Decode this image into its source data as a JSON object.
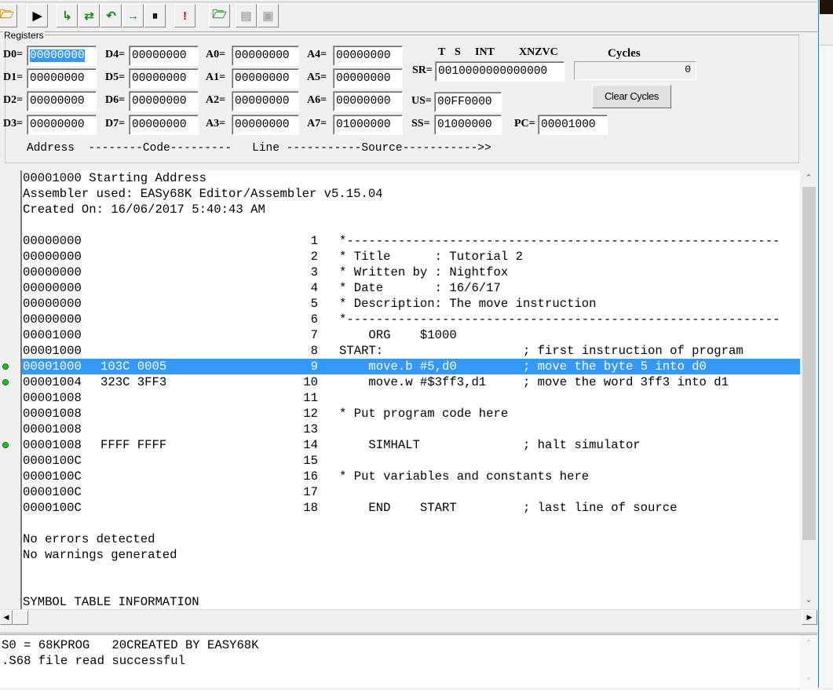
{
  "toolbar": {
    "buttons": [
      {
        "name": "open-file",
        "icon": "folder-open-icon",
        "glyph": "🗁",
        "color": "#c89b00",
        "enabled": true
      },
      {
        "name": "run",
        "icon": "run-icon",
        "glyph": "▶",
        "color": "#000",
        "enabled": true
      },
      {
        "name": "step-into",
        "icon": "step-into-icon",
        "glyph": "↳",
        "color": "#1a8a1a",
        "enabled": true
      },
      {
        "name": "step-over",
        "icon": "step-over-icon",
        "glyph": "⇄",
        "color": "#1a8a1a",
        "enabled": true
      },
      {
        "name": "trace",
        "icon": "trace-icon",
        "glyph": "↶",
        "color": "#1a8a1a",
        "enabled": true
      },
      {
        "name": "run-to-cursor",
        "icon": "run-to-cursor-icon",
        "glyph": "→",
        "color": "#1a8a1a",
        "enabled": true
      },
      {
        "name": "pause",
        "icon": "pause-icon",
        "glyph": "⏸",
        "color": "#000",
        "enabled": true
      },
      {
        "name": "reset",
        "icon": "reset-icon",
        "glyph": "!",
        "color": "#e00000",
        "enabled": true
      },
      {
        "name": "reload",
        "icon": "reload-folder-icon",
        "glyph": "🗁",
        "color": "#2a9a2a",
        "enabled": true
      },
      {
        "name": "log-start",
        "icon": "log-start-icon",
        "glyph": "▤",
        "color": "#aaa",
        "enabled": false
      },
      {
        "name": "log-stop",
        "icon": "log-stop-icon",
        "glyph": "▣",
        "color": "#aaa",
        "enabled": false
      }
    ]
  },
  "registers": {
    "group_label": "Registers",
    "D": [
      {
        "label": "D0=",
        "value": "00000000"
      },
      {
        "label": "D1=",
        "value": "00000000"
      },
      {
        "label": "D2=",
        "value": "00000000"
      },
      {
        "label": "D3=",
        "value": "00000000"
      },
      {
        "label": "D4=",
        "value": "00000000"
      },
      {
        "label": "D5=",
        "value": "00000000"
      },
      {
        "label": "D6=",
        "value": "00000000"
      },
      {
        "label": "D7=",
        "value": "00000000"
      }
    ],
    "A": [
      {
        "label": "A0=",
        "value": "00000000"
      },
      {
        "label": "A1=",
        "value": "00000000"
      },
      {
        "label": "A2=",
        "value": "00000000"
      },
      {
        "label": "A3=",
        "value": "00000000"
      },
      {
        "label": "A4=",
        "value": "00000000"
      },
      {
        "label": "A5=",
        "value": "00000000"
      },
      {
        "label": "A6=",
        "value": "00000000"
      },
      {
        "label": "A7=",
        "value": "01000000"
      }
    ],
    "sr_header": {
      "t": "T",
      "s": "S",
      "int": "INT",
      "flags": "XNZVC"
    },
    "SR": {
      "label": "SR=",
      "value": "0010000000000000"
    },
    "US": {
      "label": "US=",
      "value": "00FF0000"
    },
    "SS": {
      "label": "SS=",
      "value": "01000000"
    },
    "PC": {
      "label": "PC=",
      "value": "00001000"
    },
    "cycles_label": "Cycles",
    "cycles_value": "0",
    "clear_cycles": "Clear Cycles"
  },
  "column_header": "Address  --------Code---------   Line -----------Source----------->>",
  "listing": [
    {
      "text": "00001000 Starting Address"
    },
    {
      "text": "Assembler used: EASy68K Editor/Assembler v5.15.04"
    },
    {
      "text": "Created On: 16/06/2017 5:40:43 AM"
    },
    {
      "text": ""
    },
    {
      "addr": "00000000",
      "code": "",
      "line": "1",
      "src": "*-----------------------------------------------------------"
    },
    {
      "addr": "00000000",
      "code": "",
      "line": "2",
      "src": "* Title      : Tutorial 2"
    },
    {
      "addr": "00000000",
      "code": "",
      "line": "3",
      "src": "* Written by : Nightfox"
    },
    {
      "addr": "00000000",
      "code": "",
      "line": "4",
      "src": "* Date       : 16/6/17"
    },
    {
      "addr": "00000000",
      "code": "",
      "line": "5",
      "src": "* Description: The move instruction"
    },
    {
      "addr": "00000000",
      "code": "",
      "line": "6",
      "src": "*-----------------------------------------------------------"
    },
    {
      "addr": "00001000",
      "code": "",
      "line": "7",
      "src": "    ORG    $1000"
    },
    {
      "addr": "00001000",
      "code": "",
      "line": "8",
      "src": "START:                   ; first instruction of program"
    },
    {
      "addr": "00001000",
      "code": "103C 0005",
      "line": "9",
      "src": "    move.b #5,d0         ; move the byte 5 into d0",
      "selected": true,
      "breakpoint": true
    },
    {
      "addr": "00001004",
      "code": "323C 3FF3",
      "line": "10",
      "src": "    move.w #$3ff3,d1     ; move the word 3ff3 into d1",
      "breakpoint": true
    },
    {
      "addr": "00001008",
      "code": "",
      "line": "11",
      "src": ""
    },
    {
      "addr": "00001008",
      "code": "",
      "line": "12",
      "src": "* Put program code here"
    },
    {
      "addr": "00001008",
      "code": "",
      "line": "13",
      "src": ""
    },
    {
      "addr": "00001008",
      "code": "FFFF FFFF",
      "line": "14",
      "src": "    SIMHALT              ; halt simulator",
      "breakpoint": true
    },
    {
      "addr": "0000100C",
      "code": "",
      "line": "15",
      "src": ""
    },
    {
      "addr": "0000100C",
      "code": "",
      "line": "16",
      "src": "* Put variables and constants here"
    },
    {
      "addr": "0000100C",
      "code": "",
      "line": "17",
      "src": ""
    },
    {
      "addr": "0000100C",
      "code": "",
      "line": "18",
      "src": "    END    START         ; last line of source"
    },
    {
      "text": ""
    },
    {
      "text": "No errors detected"
    },
    {
      "text": "No warnings generated"
    },
    {
      "text": ""
    },
    {
      "text": ""
    },
    {
      "text": "SYMBOL TABLE INFORMATION"
    }
  ],
  "output": [
    "S0 = 68KPROG   20CREATED BY EASY68K",
    ".S68 file read successful"
  ],
  "colors": {
    "selection": "#3399ff",
    "breakpoint": "#22c022"
  }
}
